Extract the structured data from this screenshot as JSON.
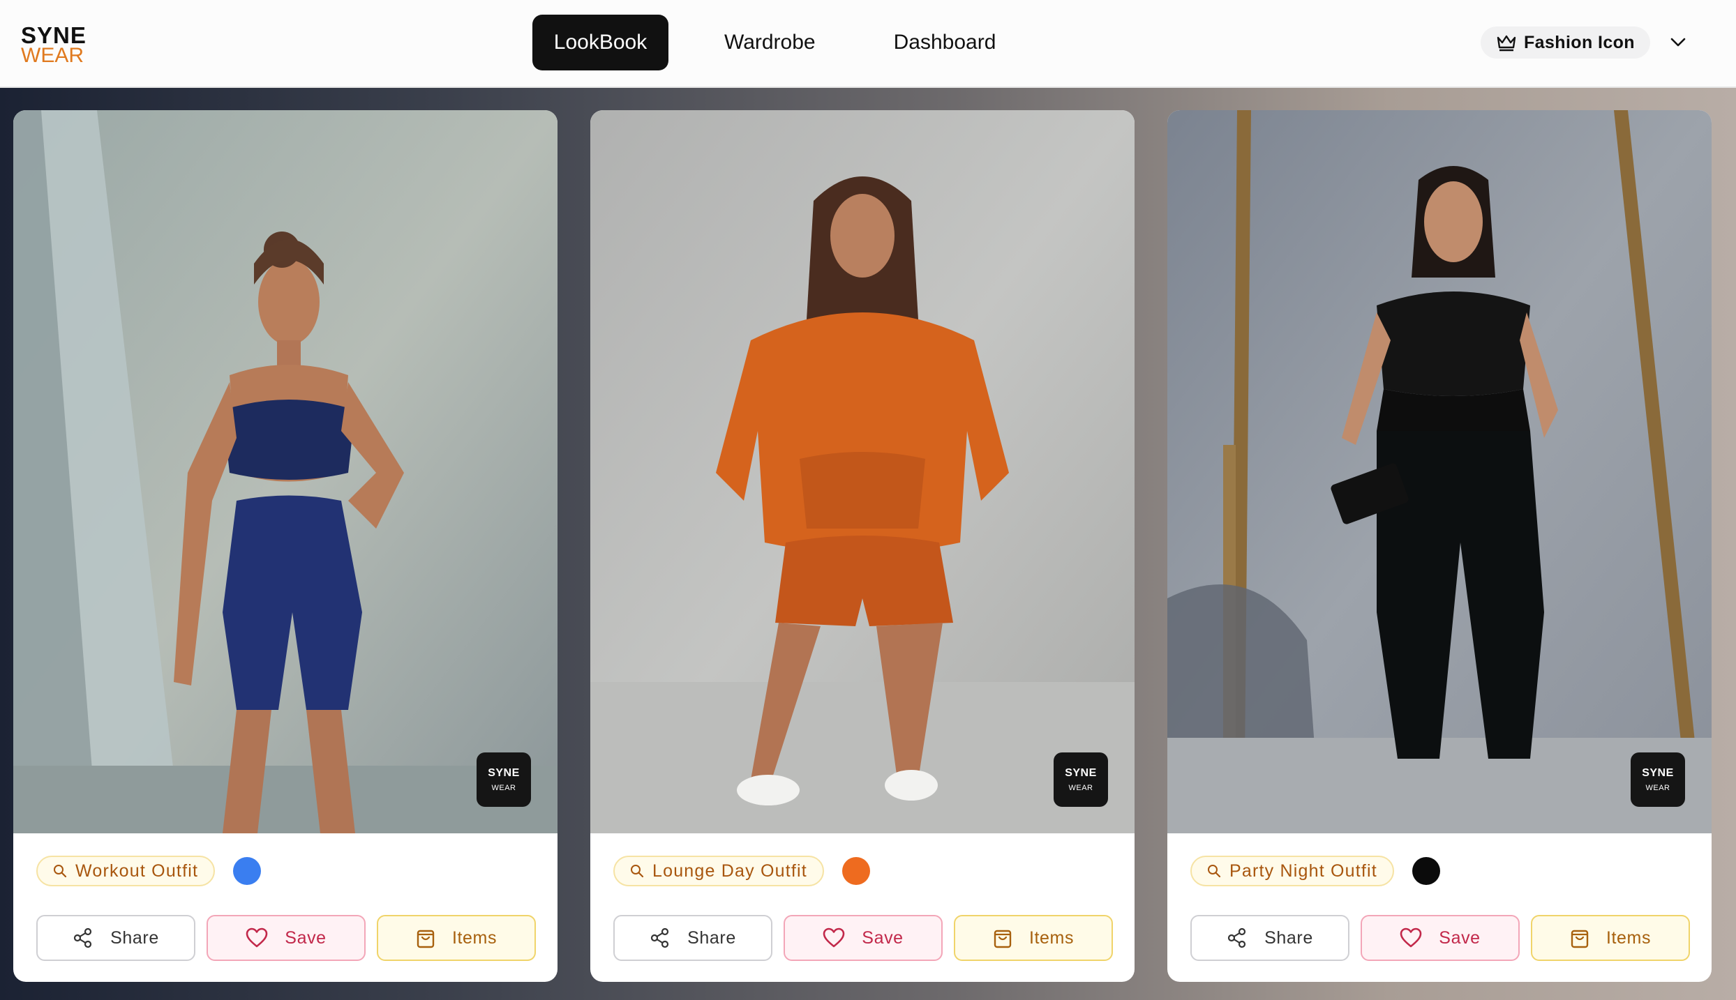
{
  "app": {
    "logo_top": "SYNE",
    "logo_bottom": "WEAR"
  },
  "nav": {
    "items": [
      {
        "label": "LookBook",
        "active": true
      },
      {
        "label": "Wardrobe",
        "active": false
      },
      {
        "label": "Dashboard",
        "active": false
      }
    ]
  },
  "user": {
    "badge_label": "Fashion Icon",
    "badge_icon": "crown-icon",
    "menu_icon": "chevron-down-icon"
  },
  "cards": [
    {
      "title": "Workout Outfit",
      "color": "#3a7ef0",
      "watermark_top": "SYNE",
      "watermark_bottom": "WEAR",
      "share_label": "Share",
      "save_label": "Save",
      "items_label": "Items"
    },
    {
      "title": "Lounge Day Outfit",
      "color": "#ee6b1f",
      "watermark_top": "SYNE",
      "watermark_bottom": "WEAR",
      "share_label": "Share",
      "save_label": "Save",
      "items_label": "Items"
    },
    {
      "title": "Party Night Outfit",
      "color": "#0b0b0b",
      "watermark_top": "SYNE",
      "watermark_bottom": "WEAR",
      "share_label": "Share",
      "save_label": "Save",
      "items_label": "Items"
    }
  ],
  "colors": {
    "accent_orange": "#e07a1f",
    "nav_active": "#111111",
    "tag_text": "#a8560e",
    "save_text": "#c2284a"
  }
}
